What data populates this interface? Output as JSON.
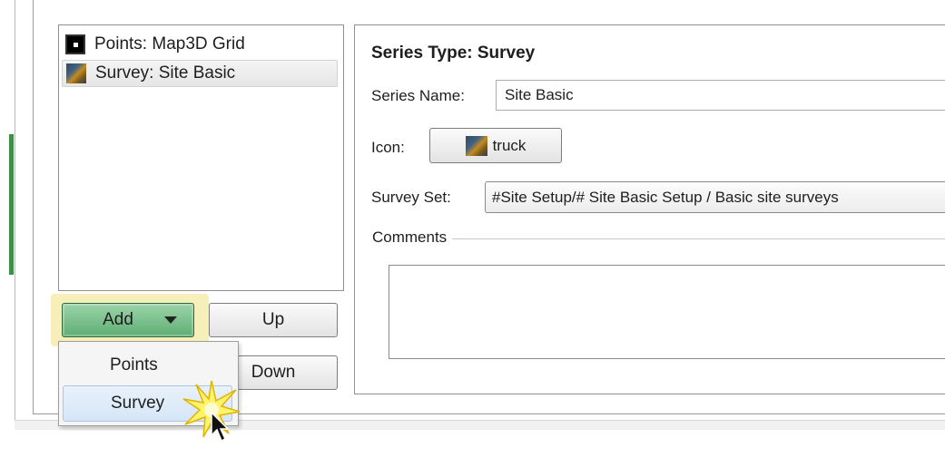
{
  "series_list": {
    "items": [
      {
        "label": "Points: Map3D Grid",
        "icon": "points-icon",
        "selected": false
      },
      {
        "label": "Survey: Site Basic",
        "icon": "truck-icon",
        "selected": true
      }
    ]
  },
  "buttons": {
    "add_label": "Add",
    "up_label": "Up",
    "down_label": "Down"
  },
  "add_menu": {
    "items": [
      {
        "label": "Points",
        "hovered": false
      },
      {
        "label": "Survey",
        "hovered": true
      }
    ]
  },
  "details": {
    "series_type": "Series Type: Survey",
    "series_name_label": "Series Name:",
    "series_name_value": "Site Basic",
    "icon_label": "Icon:",
    "icon_button_label": "truck",
    "survey_set_label": "Survey Set:",
    "survey_set_value": "#Site Setup/# Site Basic Setup / Basic site surveys",
    "comments_label": "Comments",
    "comments_value": ""
  },
  "colors": {
    "add_button": "#6fba82",
    "selection_highlight": "#d6e6f7",
    "left_accent": "#3f8e4a"
  }
}
